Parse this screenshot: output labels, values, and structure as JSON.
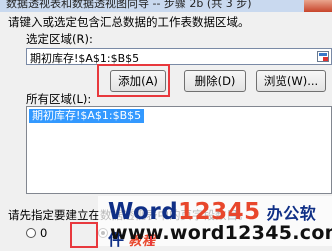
{
  "window": {
    "title": "数据透视表和数据透视图向导 -- 步骤 2b (共 3 步)"
  },
  "instruction": "请键入或选定包含汇总数据的工作表数据区域。",
  "selected_range": {
    "label": "选定区域(R):",
    "value": "期初库存!$A$1:$B$5",
    "collapse_icon": "range-collapse-icon"
  },
  "buttons": {
    "add": "添加(A)",
    "delete": "删除(D)",
    "browse": "浏览(W)..."
  },
  "all_ranges": {
    "label": "所有区域(L):",
    "items": [
      "期初库存!$A$1:$B$5"
    ]
  },
  "page_fields_prompt": "请先指定要建立在数据透视表中的页字段数目。",
  "page_field_option_0": "0",
  "watermark": {
    "brand_word": "Word",
    "brand_num": "12345",
    "cn": "办公软件",
    "jc": "教程",
    "url": "www.word12345.com"
  },
  "colors": {
    "highlight": "#e8383d",
    "selection": "#3399ff",
    "brand_blue": "#0f2f86",
    "brand_red": "#e8472c"
  }
}
